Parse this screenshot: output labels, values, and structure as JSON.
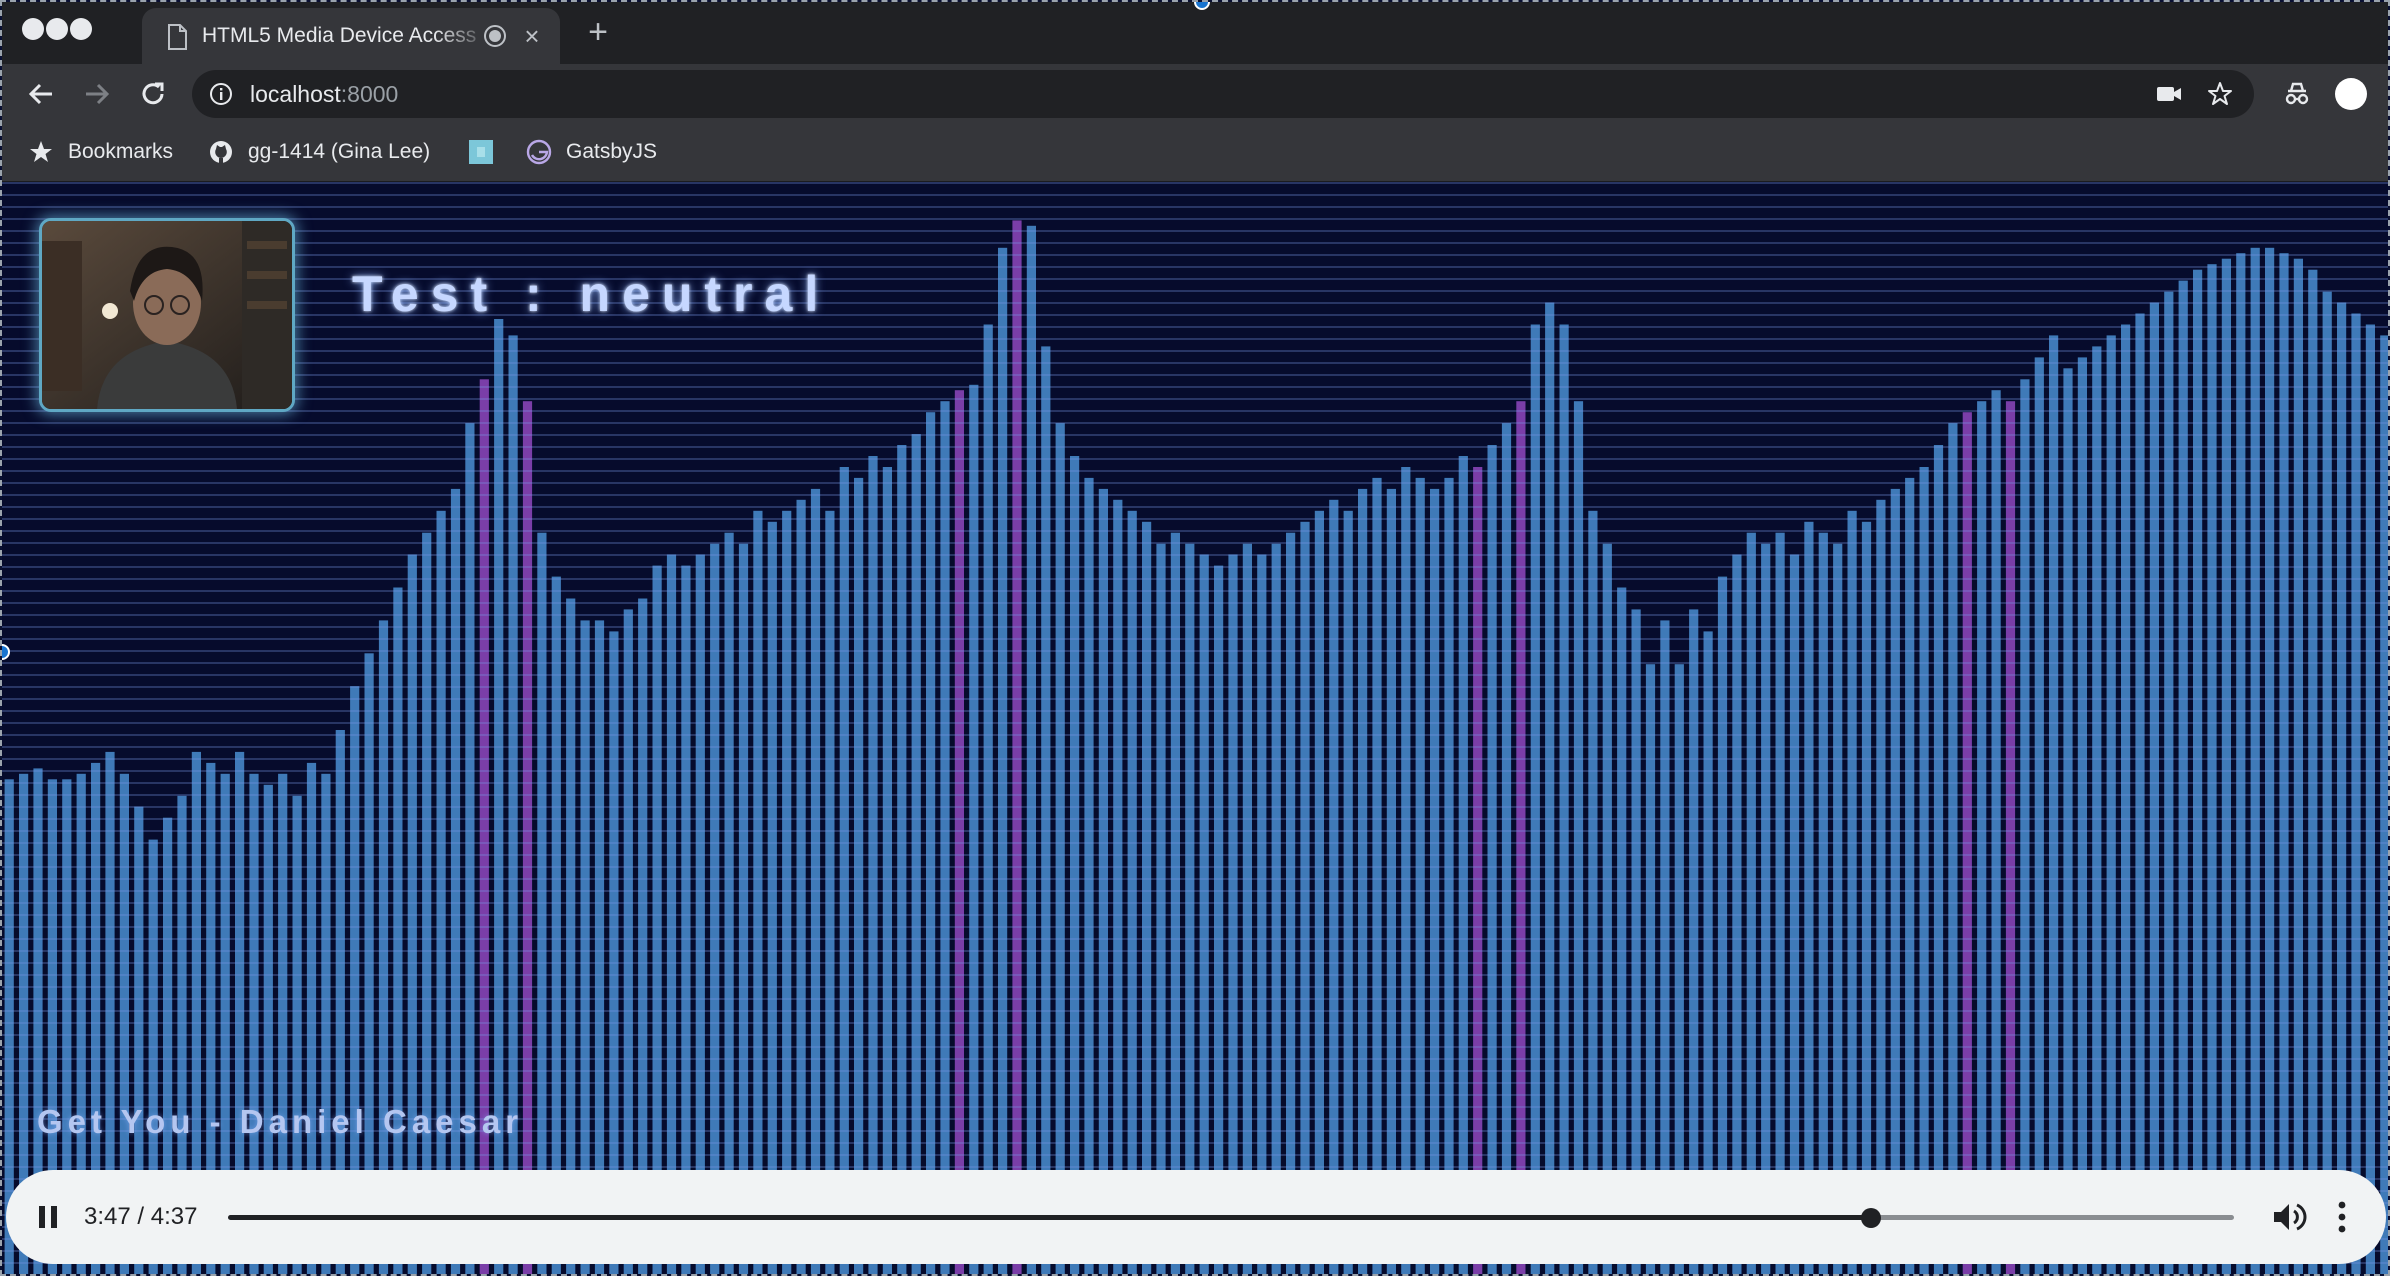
{
  "browser": {
    "tab": {
      "title": "HTML5 Media Device Access",
      "close_glyph": "×"
    },
    "new_tab_glyph": "+",
    "address": {
      "host": "localhost",
      "port": ":8000"
    },
    "bookmarks": [
      {
        "label": "Bookmarks",
        "icon": "star-icon"
      },
      {
        "label": "gg-1414 (Gina Lee)",
        "icon": "github-icon"
      },
      {
        "label": "",
        "icon": "site-favicon"
      },
      {
        "label": "GatsbyJS",
        "icon": "gatsby-icon"
      }
    ],
    "colors": {
      "chrome_dark": "#202124",
      "chrome_mid": "#35363a"
    }
  },
  "page": {
    "emotion_text": "Test : neutral",
    "song_text": "Get You - Daniel Caesar",
    "colors": {
      "background": "#060b2c",
      "bar": "#3f7ab8",
      "bar_highlight": "#7a3ea8",
      "glow": "#c6d7ff"
    },
    "visualizer": {
      "bar_levels": [
        0.455,
        0.46,
        0.465,
        0.455,
        0.455,
        0.46,
        0.47,
        0.48,
        0.46,
        0.43,
        0.4,
        0.42,
        0.44,
        0.48,
        0.47,
        0.46,
        0.48,
        0.46,
        0.45,
        0.46,
        0.44,
        0.47,
        0.46,
        0.5,
        0.54,
        0.57,
        0.6,
        0.63,
        0.66,
        0.68,
        0.7,
        0.72,
        0.78,
        0.82,
        0.875,
        0.86,
        0.8,
        0.68,
        0.64,
        0.62,
        0.6,
        0.6,
        0.59,
        0.61,
        0.62,
        0.65,
        0.66,
        0.65,
        0.66,
        0.67,
        0.68,
        0.67,
        0.7,
        0.69,
        0.7,
        0.71,
        0.72,
        0.7,
        0.74,
        0.73,
        0.75,
        0.74,
        0.76,
        0.77,
        0.79,
        0.8,
        0.81,
        0.815,
        0.87,
        0.94,
        0.965,
        0.96,
        0.85,
        0.78,
        0.75,
        0.73,
        0.72,
        0.71,
        0.7,
        0.69,
        0.67,
        0.68,
        0.67,
        0.66,
        0.65,
        0.66,
        0.67,
        0.66,
        0.67,
        0.68,
        0.69,
        0.7,
        0.71,
        0.7,
        0.72,
        0.73,
        0.72,
        0.74,
        0.73,
        0.72,
        0.73,
        0.75,
        0.74,
        0.76,
        0.78,
        0.8,
        0.87,
        0.89,
        0.87,
        0.8,
        0.7,
        0.67,
        0.63,
        0.61,
        0.56,
        0.6,
        0.56,
        0.61,
        0.59,
        0.64,
        0.66,
        0.68,
        0.67,
        0.68,
        0.66,
        0.69,
        0.68,
        0.67,
        0.7,
        0.69,
        0.71,
        0.72,
        0.73,
        0.74,
        0.76,
        0.78,
        0.79,
        0.8,
        0.81,
        0.8,
        0.82,
        0.84,
        0.86,
        0.83,
        0.84,
        0.85,
        0.86,
        0.87,
        0.88,
        0.89,
        0.9,
        0.91,
        0.92,
        0.925,
        0.93,
        0.935,
        0.94,
        0.94,
        0.935,
        0.93,
        0.92,
        0.9,
        0.89,
        0.88,
        0.87,
        0.86
      ],
      "highlighted_bars": [
        33,
        36,
        66,
        70,
        102,
        105,
        136,
        139
      ]
    },
    "player": {
      "time_display": "3:47 / 4:37",
      "progress": 0.819
    }
  }
}
